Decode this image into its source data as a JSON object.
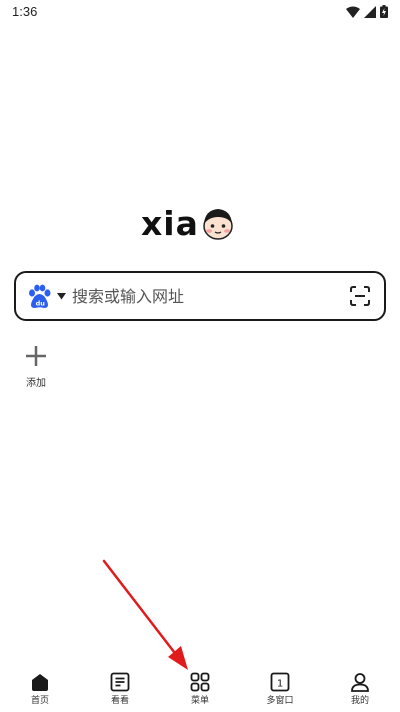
{
  "status_bar": {
    "time": "1:36"
  },
  "logo": {
    "text": "xia"
  },
  "search": {
    "engine_icon": "baidu-paw-icon",
    "placeholder": "搜索或输入网址",
    "engine_color": "#2b5ff0"
  },
  "shortcuts": {
    "add_label": "添加"
  },
  "bottom_nav": [
    {
      "label": "首页",
      "icon": "home-icon"
    },
    {
      "label": "看看",
      "icon": "article-icon"
    },
    {
      "label": "菜单",
      "icon": "grid-menu-icon"
    },
    {
      "label": "多窗口",
      "icon": "window-count-icon",
      "count": "1"
    },
    {
      "label": "我的",
      "icon": "profile-icon"
    }
  ],
  "annotation": {
    "arrow_color": "#e01b1b"
  }
}
